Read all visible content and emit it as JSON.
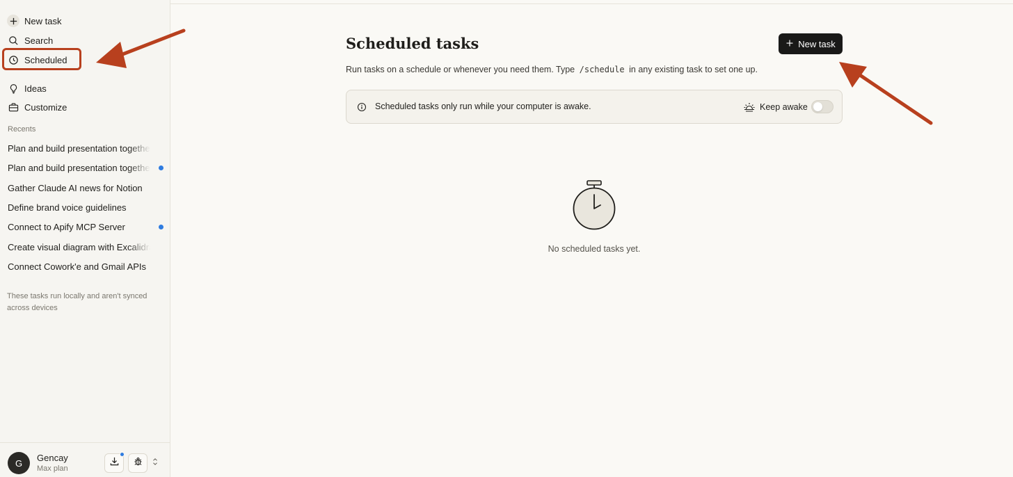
{
  "sidebar": {
    "nav": [
      {
        "label": "New task",
        "icon": "plus-icon"
      },
      {
        "label": "Search",
        "icon": "search-icon"
      },
      {
        "label": "Scheduled",
        "icon": "clock-icon"
      },
      {
        "label": "Ideas",
        "icon": "lightbulb-icon"
      },
      {
        "label": "Customize",
        "icon": "briefcase-icon"
      }
    ],
    "recents_label": "Recents",
    "recents": [
      {
        "title": "Plan and build presentation together",
        "unread": false
      },
      {
        "title": "Plan and build presentation together",
        "unread": true
      },
      {
        "title": "Gather Claude AI news for Notion",
        "unread": false
      },
      {
        "title": "Define brand voice guidelines",
        "unread": false
      },
      {
        "title": "Connect to Apify MCP Server",
        "unread": true
      },
      {
        "title": "Create visual diagram with Excalidraw",
        "unread": false
      },
      {
        "title": "Connect Cowork'e and Gmail APIs",
        "unread": false
      }
    ],
    "note": "These tasks run locally and aren't synced across devices",
    "user": {
      "initial": "G",
      "name": "Gencay",
      "plan": "Max plan"
    }
  },
  "main": {
    "title": "Scheduled tasks",
    "new_task_label": "New task",
    "subtitle_before": "Run tasks on a schedule or whenever you need them. Type",
    "subtitle_code": "/schedule",
    "subtitle_after": "in any existing task to set one up.",
    "notice": "Scheduled tasks only run while your computer is awake.",
    "keep_awake_label": "Keep awake",
    "keep_awake_on": false,
    "empty_text": "No scheduled tasks yet."
  },
  "colors": {
    "accent_annotation": "#b8401e",
    "unread_dot": "#2f7ce0",
    "primary_button": "#191918"
  }
}
